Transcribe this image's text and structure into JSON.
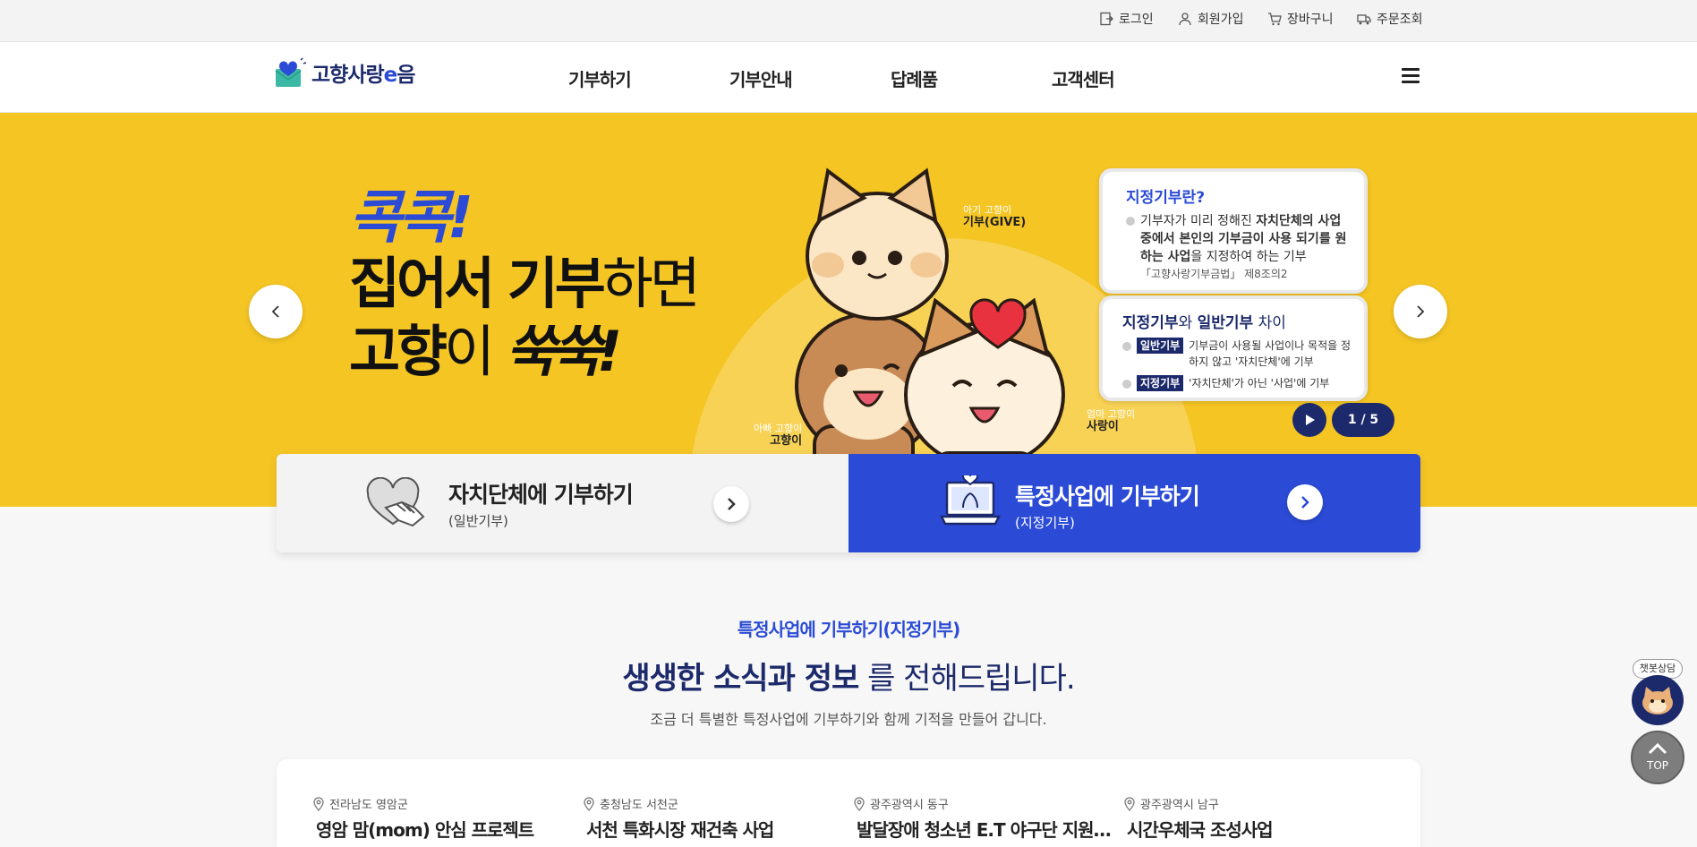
{
  "topbar": {
    "login": "로그인",
    "signup": "회원가입",
    "cart": "장바구니",
    "orders": "주문조회"
  },
  "header": {
    "logo_prefix": "고향사랑",
    "logo_e": "e",
    "logo_suffix": "음",
    "nav": [
      "기부하기",
      "기부안내",
      "답례품",
      "고객센터"
    ]
  },
  "banner": {
    "kok": "콕콕!",
    "line1_bold": "집어서 기부",
    "line1_thin": "하면",
    "line2_bold": "고향",
    "line2_thin": "이 ",
    "line2_sk": "쑥쑥!",
    "characters": {
      "baby": {
        "sub": "아기 고향이",
        "name": "기부(GIVE)"
      },
      "dad": {
        "sub": "아빠 고향이",
        "name": "고향이"
      },
      "mom": {
        "sub": "엄마 고향이",
        "name": "사랑이"
      }
    },
    "card1": {
      "title": "지정기부란?",
      "text_a": "기부자가 미리 정해진 ",
      "text_b": "자치단체의 사업 중에서 본인의 기부금이 사용 되기를 원하는 사업",
      "text_c": "을 지정하여 하는 기부",
      "law": "「고향사랑기부금법」 제8조의2"
    },
    "card2": {
      "title_a": "지정기부",
      "title_b": "와 ",
      "title_c": "일반기부",
      "title_d": " 차이",
      "row1_tag": "일반기부",
      "row1_text": "기부금이 사용될 사업이나 목적을 정하지 않고 '자치단체'에 기부",
      "row2_tag": "지정기부",
      "row2_text": "'자치단체'가 아닌 '사업'에 기부"
    },
    "slide_counter": "1 / 5"
  },
  "donate": {
    "general_title": "자치단체에 기부하기",
    "general_sub": "(일반기부)",
    "specific_title": "특정사업에 기부하기",
    "specific_sub": "(지정기부)"
  },
  "section": {
    "kicker": "특정사업에 기부하기(지정기부)",
    "title_bold": "생생한 소식과 정보",
    "title_rest": "를 전해드립니다.",
    "desc": "조금 더 특별한 특정사업에 기부하기와 함께 기적을 만들어 갑니다."
  },
  "projects": [
    {
      "location": "전라남도 영암군",
      "name": "영암 맘(mom) 안심 프로젝트"
    },
    {
      "location": "충청남도 서천군",
      "name": "서천 특화시장 재건축 사업"
    },
    {
      "location": "광주광역시 동구",
      "name": "발달장애 청소년 E.T 야구단 지원 사업"
    },
    {
      "location": "광주광역시 남구",
      "name": "시간우체국 조성사업"
    }
  ],
  "floating": {
    "chat_label": "챗봇상담",
    "top_label": "TOP"
  },
  "colors": {
    "brand_blue": "#2b4bd6",
    "navy": "#1c2a6b",
    "banner_yellow": "#f5c524"
  }
}
